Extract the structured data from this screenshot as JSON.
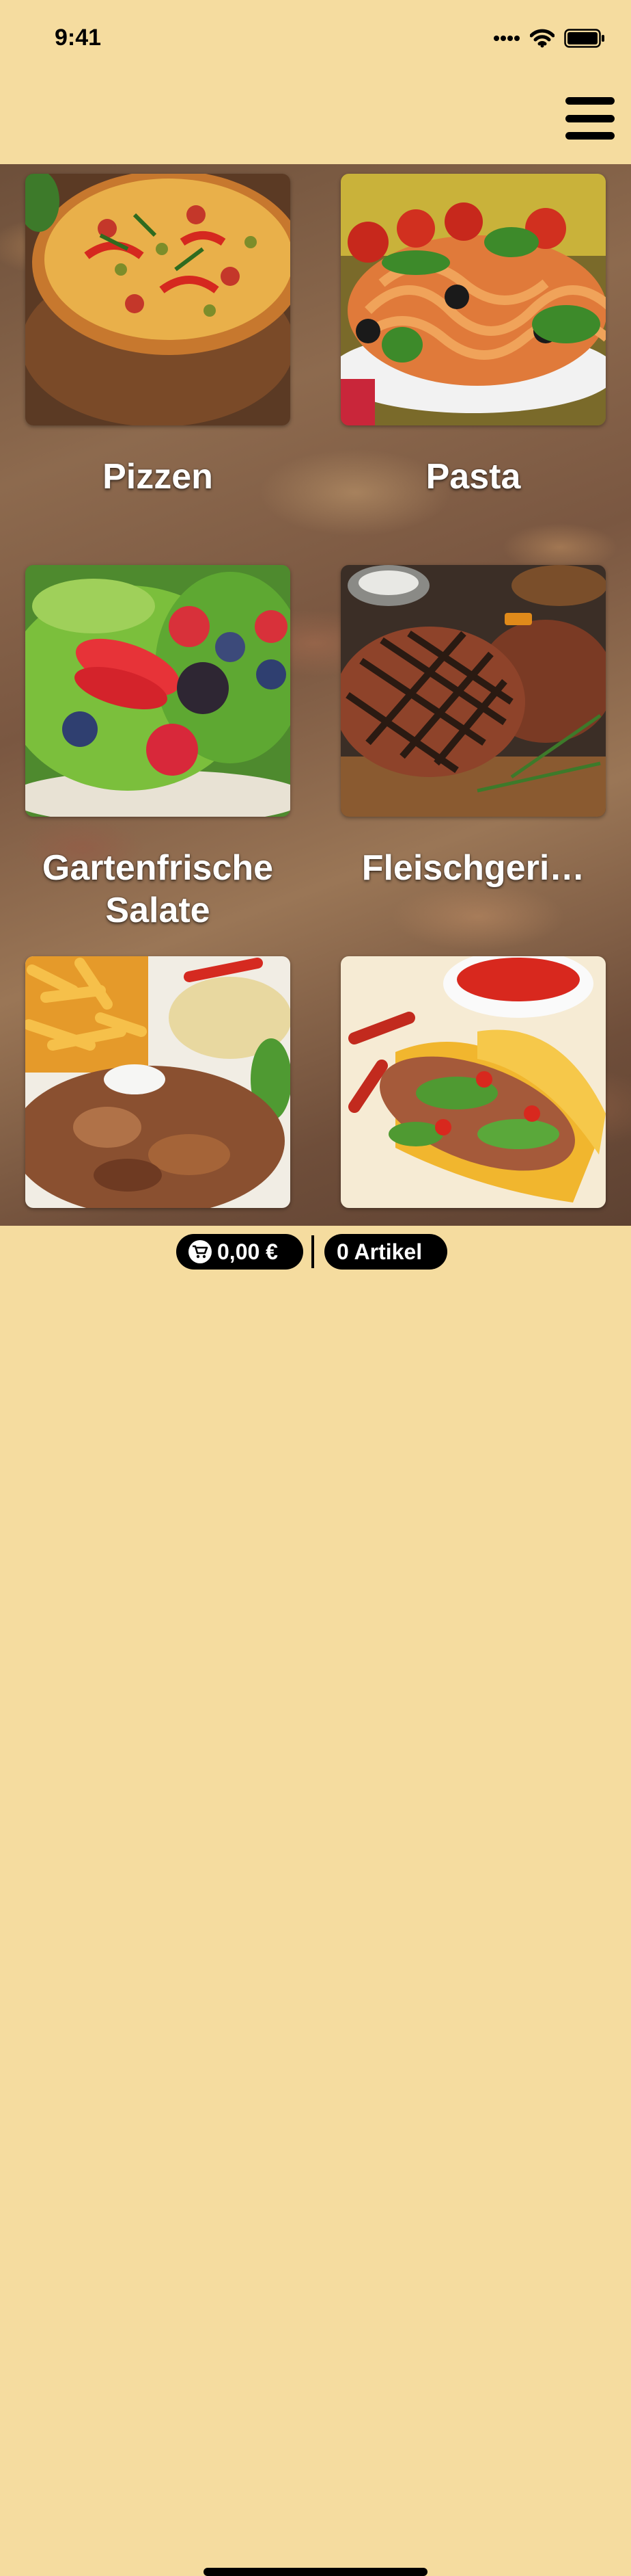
{
  "status_bar": {
    "time": "9:41",
    "icons": [
      "cellular-signal-icon",
      "wifi-icon",
      "battery-icon"
    ]
  },
  "header": {
    "menu_icon": "hamburger-menu-icon"
  },
  "categories": [
    {
      "label": "Pizzen",
      "image": "pizza"
    },
    {
      "label": "Pasta",
      "image": "pasta"
    },
    {
      "label": "Gartenfrische Salate",
      "image": "salad"
    },
    {
      "label": "Fleischgeri…",
      "image": "steak"
    },
    {
      "label": "",
      "image": "doner-kebab"
    },
    {
      "label": "",
      "image": "tacos"
    }
  ],
  "cart": {
    "price": "0,00 €",
    "items": "0 Artikel",
    "icon": "shopping-cart-icon"
  },
  "colors": {
    "background": "#f5dc9f",
    "pill": "#000000",
    "pill_text": "#ffffff"
  }
}
